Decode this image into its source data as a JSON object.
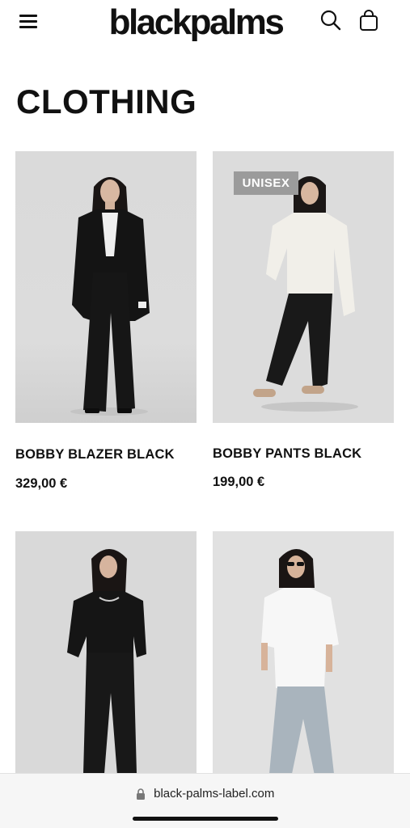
{
  "header": {
    "logo": "blackpalms",
    "menu_icon": "hamburger-menu-icon",
    "search_icon": "search-icon",
    "bag_icon": "shopping-bag-icon"
  },
  "page": {
    "title": "CLOTHING"
  },
  "products": [
    {
      "name": "BOBBY BLAZER BLACK",
      "price": "329,00 €",
      "badge": ""
    },
    {
      "name": "BOBBY PANTS BLACK",
      "price": "199,00 €",
      "badge": "UNISEX"
    },
    {
      "name": "",
      "price": "",
      "badge": ""
    },
    {
      "name": "",
      "price": "",
      "badge": ""
    }
  ],
  "browser": {
    "url": "black-palms-label.com",
    "lock_icon": "lock-icon"
  },
  "colors": {
    "text": "#111111",
    "badge_bg": "#9b9b9b",
    "photo_bg": "#dadada"
  }
}
